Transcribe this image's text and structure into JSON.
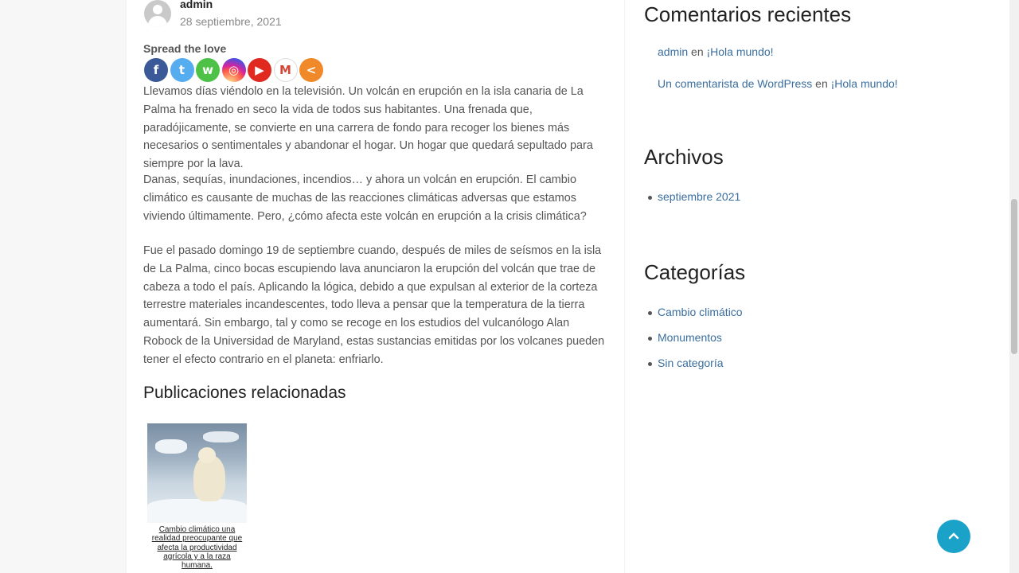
{
  "post": {
    "author": "admin",
    "date": "28 septiembre, 2021",
    "spread_label": "Spread the love",
    "share_buttons": [
      {
        "name": "facebook",
        "glyph": "f"
      },
      {
        "name": "twitter",
        "glyph": "t"
      },
      {
        "name": "whatsapp",
        "glyph": "w"
      },
      {
        "name": "instagram",
        "glyph": "◎"
      },
      {
        "name": "youtube",
        "glyph": "▶"
      },
      {
        "name": "gmail",
        "glyph": "M"
      },
      {
        "name": "more",
        "glyph": "<"
      }
    ],
    "paragraphs": [
      "Llevamos días viéndolo en la televisión. Un volcán en erupción en la isla canaria de La Palma ha frenado en seco la vida de todos sus habitantes. Una frenada que, paradójicamente, se convierte en una carrera de fondo para recoger los bienes más necesarios o sentimentales y abandonar el hogar. Un hogar que quedará sepultado para siempre por la lava.",
      "Danas, sequías, inundaciones, incendios… y ahora un volcán en erupción. El cambio climático es causante de muchas de las reacciones climáticas adversas que estamos viviendo últimamente. Pero, ¿cómo afecta este volcán en erupción a la crisis climática?",
      "Fue el pasado domingo 19 de septiembre cuando, después de miles de seísmos en la isla de La Palma, cinco bocas escupiendo lava anunciaron la erupción del volcán que trae de cabeza a todo el país. Aplicando la lógica, debido a que expulsan al exterior de la corteza terrestre materiales incandescentes, todo lleva a pensar que la temperatura de la tierra aumentará. Sin embargo, tal y como se recoge en los estudios del vulcanólogo Alan Robock de la Universidad de Maryland, estas sustancias emitidas por los volcanes pueden tener el efecto contrario en el planeta: enfriarlo."
    ],
    "related_title": "Publicaciones relacionadas",
    "related_caption": "Cambio climático una realidad preocupante que afecta la productividad agrícola y a la raza humana."
  },
  "sidebar": {
    "recent_comments_title": "Comentarios recientes",
    "comments": [
      {
        "author": "admin",
        "sep": "en",
        "post": "¡Hola mundo!"
      },
      {
        "author": "Un comentarista de WordPress",
        "sep": "en",
        "post": "¡Hola mundo!"
      }
    ],
    "archives_title": "Archivos",
    "archives": [
      "septiembre 2021"
    ],
    "categories_title": "Categorías",
    "categories": [
      "Cambio climático",
      "Monumentos",
      "Sin categoría"
    ]
  },
  "colors": {
    "link": "#3a6e9e",
    "to_top": "#1aa2c9"
  },
  "to_top_icon": "chevron-up-icon"
}
